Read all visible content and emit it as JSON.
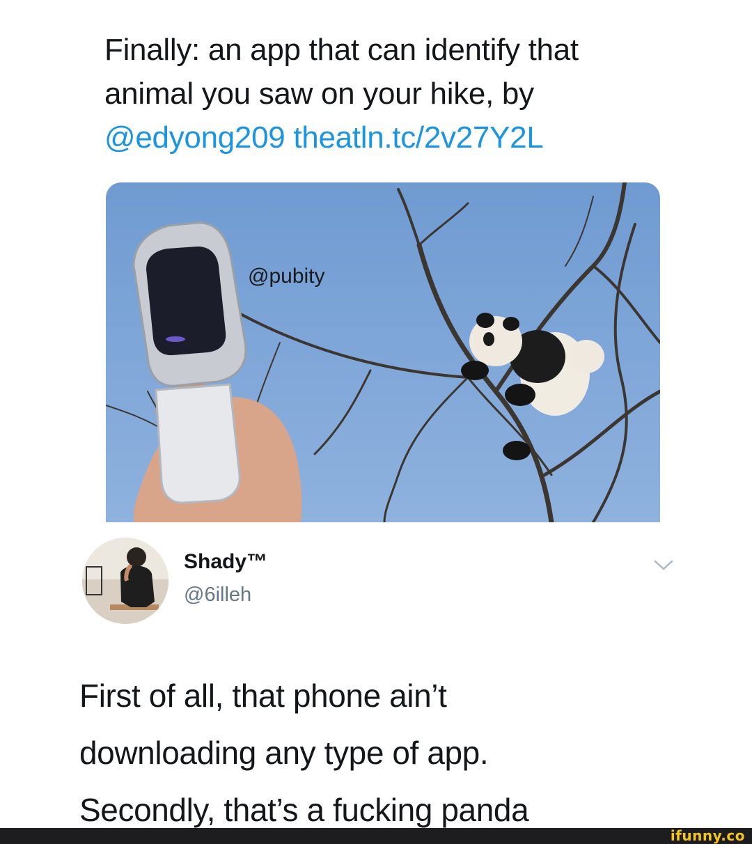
{
  "quoted_tweet": {
    "line1": "Finally: an app that can identify that",
    "line2": "animal you saw on your hike, by",
    "mention": "@edyong209",
    "link": "theatln.tc/2v27Y2L"
  },
  "media": {
    "watermark": "@pubity",
    "sky_color": "#7ea6d8"
  },
  "author": {
    "display_name": "Shady™",
    "handle": "@6illeh"
  },
  "tweet": {
    "line1": "First of all, that phone ain’t",
    "line2": "downloading any type of app.",
    "line3": "Secondly, that’s a fucking panda"
  },
  "footer": {
    "logo": "ifunny.co"
  },
  "icons": {
    "menu": "chevron-down-icon"
  },
  "colors": {
    "link": "#1b95e0",
    "handle": "#657786",
    "text": "#14171a",
    "footer_bg": "#1d1d1f",
    "footer_logo": "#f5c518"
  }
}
